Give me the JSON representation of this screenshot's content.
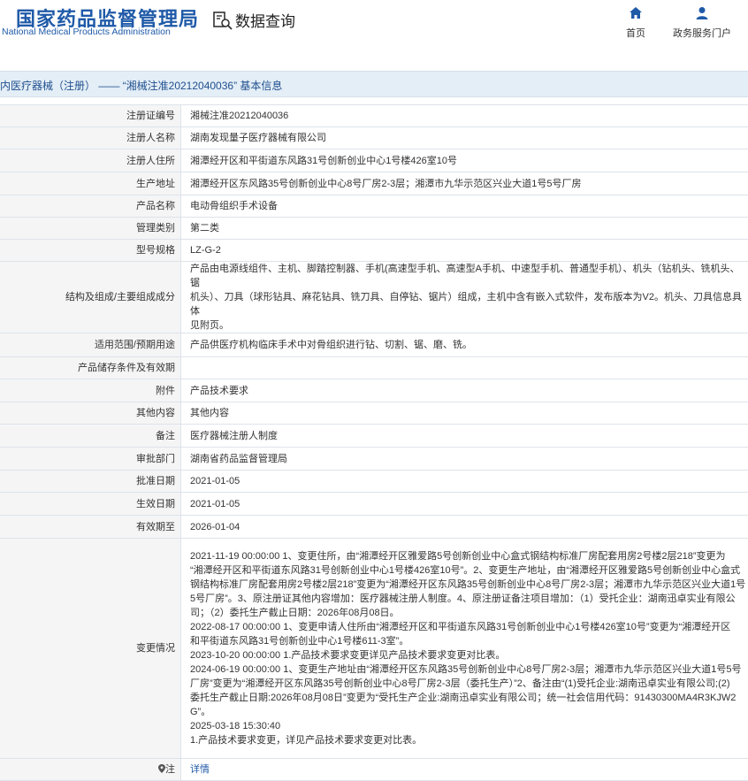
{
  "header": {
    "logo_cn": "国家药品监督管理局",
    "logo_en": "National Medical Products Administration",
    "query_label": "数据查询",
    "nav": {
      "home": "首页",
      "gov": "政务服务门户"
    }
  },
  "title": "内医疗器械（注册） —— “湘械注准20212040036” 基本信息",
  "rows": [
    {
      "label": "注册证编号",
      "value": "湘械注准20212040036"
    },
    {
      "label": "注册人名称",
      "value": "湖南发现量子医疗器械有限公司"
    },
    {
      "label": "注册人住所",
      "value": "湘潭经开区和平街道东风路31号创新创业中心1号楼426室10号"
    },
    {
      "label": "生产地址",
      "value": "湘潭经开区东风路35号创新创业中心8号厂房2-3层；湘潭市九华示范区兴业大道1号5号厂房"
    },
    {
      "label": "产品名称",
      "value": "电动骨组织手术设备"
    },
    {
      "label": "管理类别",
      "value": "第二类"
    },
    {
      "label": "型号规格",
      "value": "LZ-G-2"
    },
    {
      "label": "结构及组成/主要组成成分",
      "lines": [
        "产品由电源线组件、主机、脚踏控制器、手机(高速型手机、高速型A手机、中速型手机、普通型手机）、机头（钻机头、铣机头、锯",
        "机头）、刀具（球形钻具、麻花钻具、铣刀具、自停钻、锯片）组成，主机中含有嵌入式软件，发布版本为V2。机头、刀具信息具体",
        "见附页。"
      ]
    },
    {
      "label": "适用范围/预期用途",
      "value": "产品供医疗机构临床手术中对骨组织进行钻、切割、锯、磨、铣。"
    },
    {
      "label": "产品储存条件及有效期",
      "value": ""
    },
    {
      "label": "附件",
      "value": "产品技术要求"
    },
    {
      "label": "其他内容",
      "value": "其他内容"
    },
    {
      "label": "备注",
      "value": "医疗器械注册人制度"
    },
    {
      "label": "审批部门",
      "value": "湖南省药品监督管理局"
    },
    {
      "label": "批准日期",
      "value": "2021-01-05"
    },
    {
      "label": "生效日期",
      "value": "2021-01-05"
    },
    {
      "label": "有效期至",
      "value": "2026-01-04"
    },
    {
      "label": "变更情况",
      "lines": [
        "2021-11-19 00:00:00 1、变更住所，由“湘潭经开区雅爱路5号创新创业中心盒式钢结构标准厂房配套用房2号楼2层218”变更为",
        "“湘潭经开区和平街道东风路31号创新创业中心1号楼426室10号”。2、变更生产地址，由“湘潭经开区雅爱路5号创新创业中心盒式",
        "钢结构标准厂房配套用房2号楼2层218”变更为“湘潭经开区东风路35号创新创业中心8号厂房2-3层；湘潭市九华示范区兴业大道1号",
        "5号厂房”。3、原注册证其他内容增加：医疗器械注册人制度。4、原注册证备注项目增加：（1）受托企业：湖南迅卓实业有限公",
        "司；（2）委托生产截止日期：2026年08月08日。",
        "2022-08-17 00:00:00 1、变更申请人住所由“湘潭经开区和平街道东风路31号创新创业中心1号楼426室10号”变更为“湘潭经开区",
        "和平街道东风路31号创新创业中心1号楼611-3室”。",
        "2023-10-20 00:00:00 1.产品技术要求变更详见产品技术要求变更对比表。",
        "2024-06-19 00:00:00 1、变更生产地址由“湘潭经开区东风路35号创新创业中心8号厂房2-3层；湘潭市九华示范区兴业大道1号5号",
        "厂房”变更为“湘潭经开区东风路35号创新创业中心8号厂房2-3层（委托生产）”2、备注由“(1)受托企业:湖南迅卓实业有限公司;(2)",
        "委托生产截止日期:2026年08月08日”变更为“受托生产企业:湖南迅卓实业有限公司；统一社会信用代码：91430300MA4R3KJW2",
        "G”。",
        "2025-03-18 15:30:40",
        "1.产品技术要求变更，详见产品技术要求变更对比表。"
      ]
    },
    {
      "label": "注",
      "value": "详情",
      "link": true
    }
  ],
  "colors": {
    "brand": "#1f5aa8",
    "title_bar": "#e4eef6",
    "label_bg": "#f5f5f5",
    "border": "#dde3ea"
  }
}
